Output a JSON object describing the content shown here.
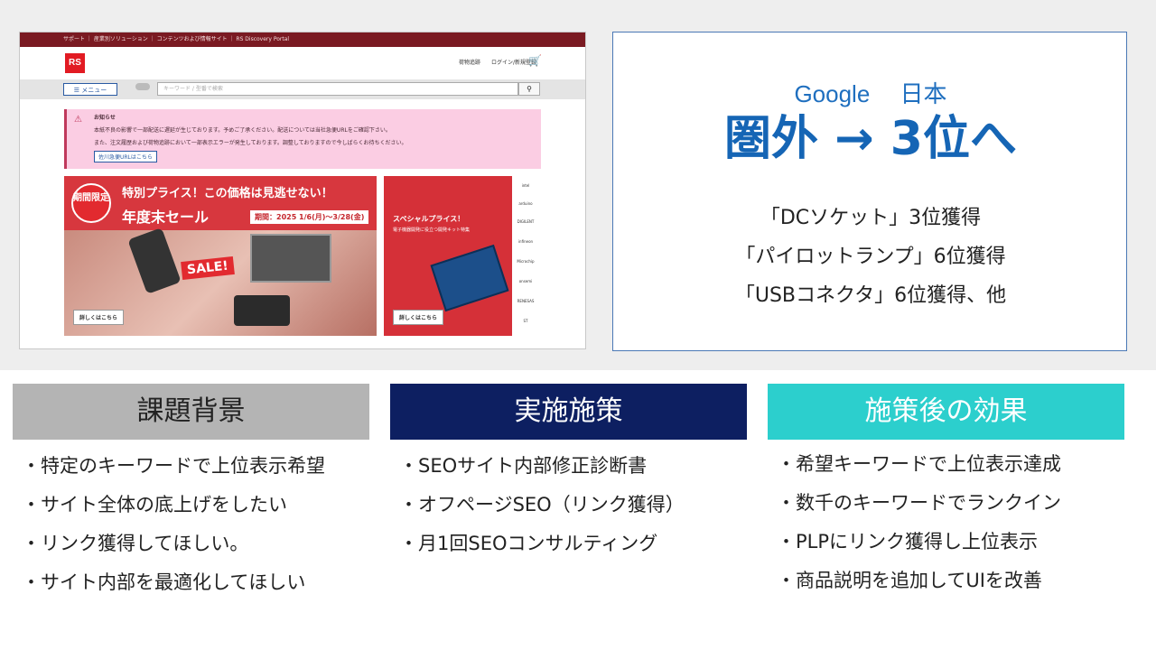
{
  "screenshot": {
    "utility_links": [
      "サポート",
      "産業別ソリューション",
      "コンテンツおよび情報サイト",
      "RS Discovery Portal"
    ],
    "logo_text": "RS",
    "header_links": [
      "荷物追跡",
      "ログイン/新規登録"
    ],
    "menu_label": "☰ メニュー",
    "search_placeholder": "キーワード / 型番で検索",
    "notice": {
      "title": "お知らせ",
      "line1": "本紙不良の影響で一部配送に遅延が生じております。予めご了承ください。配送については当社急便URLをご確認下さい。",
      "line2": "また、注文履歴および荷物追跡において一部表示エラーが発生しております。調整しておりますので今しばらくお待ちください。",
      "button": "佐川急便URLはこちら"
    },
    "banner1": {
      "badge": "期間限定",
      "headline": "特別プライス！この価格は見逃せない！",
      "title": "年度末セール",
      "period": "期間：2025 1/6(月)〜3/28(金)",
      "sale": "SALE!",
      "more": "詳しくはこちら"
    },
    "banner2": {
      "headline": "スペシャルプライス！",
      "sub": "電子機器開発に役立つ開発キット特集",
      "more": "詳しくはこちら",
      "brands": [
        "intel",
        "arduino",
        "DIGILENT",
        "infineon",
        "Microchip",
        "onsemi",
        "RENESAS",
        "ST"
      ]
    }
  },
  "ranking": {
    "subtitle": "Google　 日本",
    "headline": "圏外 → 3位へ",
    "keywords": [
      "「DCソケット」3位獲得",
      "「パイロットランプ」6位獲得",
      "「USBコネクタ」6位獲得、他"
    ]
  },
  "columns": [
    {
      "title": "課題背景",
      "items": [
        "・特定のキーワードで上位表示希望",
        "・サイト全体の底上げをしたい",
        "・リンク獲得してほしい。",
        "・サイト内部を最適化してほしい"
      ]
    },
    {
      "title": "実施施策",
      "items": [
        "・SEOサイト内部修正診断書",
        "・オフページSEO（リンク獲得）",
        "・月1回SEOコンサルティング"
      ]
    },
    {
      "title": "施策後の効果",
      "items": [
        "・希望キーワードで上位表示達成",
        "・数千のキーワードでランクイン",
        "・PLPにリンク獲得し上位表示",
        "・商品説明を追加してUIを改善"
      ]
    }
  ]
}
